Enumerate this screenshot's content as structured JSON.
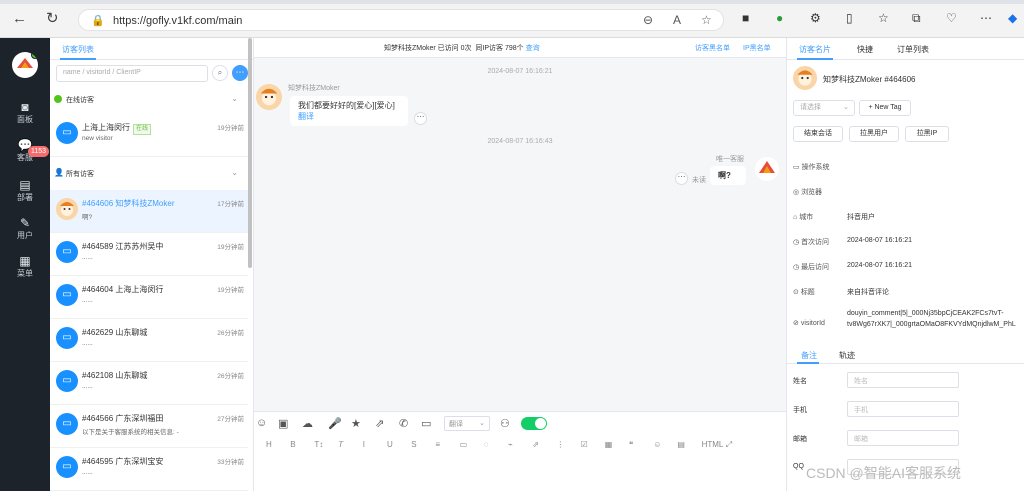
{
  "browser": {
    "url": "https://gofly.v1kf.com/main"
  },
  "sidebar": {
    "items": [
      "面板",
      "客服",
      "部署",
      "用户",
      "菜单"
    ],
    "badge": "1153"
  },
  "visitors": {
    "tab": "访客列表",
    "search_placeholder": "name / visitorId / ClientIP",
    "online_group": "在线访客",
    "all_group": "所有访客",
    "online": [
      {
        "name": "上海上海闵行",
        "tag": "在线",
        "time": "19分钟前",
        "msg": "new visitor"
      }
    ],
    "list": [
      {
        "name": "#464606 知梦科技ZMoker",
        "time": "17分钟前",
        "msg": "啊?"
      },
      {
        "name": "#464589 江苏苏州吴中",
        "time": "19分钟前",
        "msg": "......"
      },
      {
        "name": "#464604 上海上海闵行",
        "time": "19分钟前",
        "msg": "......"
      },
      {
        "name": "#462629 山东聊城",
        "time": "26分钟前",
        "msg": "......"
      },
      {
        "name": "#462108 山东聊城",
        "time": "26分钟前",
        "msg": "......"
      },
      {
        "name": "#464566 广东深圳福田",
        "time": "27分钟前",
        "msg": "以下是关于客服系统的相关信息: -"
      },
      {
        "name": "#464595 广东深圳宝安",
        "time": "33分钟前",
        "msg": "......"
      }
    ]
  },
  "chat": {
    "header": {
      "prefix": "知梦科技ZMoker 已访问 0次",
      "same_ip": "同IP访客",
      "count": "798个",
      "query": "查询",
      "blacklist": "访客黑名单",
      "ip_blacklist": "IP黑名单"
    },
    "messages": [
      {
        "time": "2024-08-07 16:16:21",
        "sender": "知梦科技ZMoker",
        "text": "我们都要好好的[爱心][爱心]",
        "translate": "翻译"
      },
      {
        "time": "2024-08-07 16:16:43",
        "sender": "唯一客服",
        "text": "啊?",
        "status": "未读"
      }
    ],
    "toolbar": {
      "translate": "翻译",
      "fmt": [
        "H",
        "B",
        "T↕",
        "𝑇",
        "I",
        "U",
        "S",
        "≡",
        "▭",
        "◌",
        "⌁",
        "⇗",
        "⋮",
        "☑",
        "▦",
        "❝",
        "☺",
        "▤",
        "HTML",
        "⤢"
      ]
    }
  },
  "info": {
    "tabs": [
      "访客名片",
      "快捷",
      "订单列表"
    ],
    "name": "知梦科技ZMoker #464606",
    "select_placeholder": "请选择",
    "new_tag": "+ New Tag",
    "buttons": [
      "结束会话",
      "拉黑用户",
      "拉黑IP"
    ],
    "rows": [
      {
        "k": "操作系统",
        "v": ""
      },
      {
        "k": "浏览器",
        "v": ""
      },
      {
        "k": "城市",
        "v": "抖音用户"
      },
      {
        "k": "首次访问",
        "v": "2024-08-07 16:16:21"
      },
      {
        "k": "最后访问",
        "v": "2024-08-07 16:16:21"
      },
      {
        "k": "标题",
        "v": "来自抖音评论"
      },
      {
        "k": "visitorId",
        "v": "douyin_comment|5|_000Nj35bpCjCEAK2FCs7tvT-",
        "v2": "tv8Wg67rXK7|_000grtaOMaO8FKVYdMQnjdlwM_PhL"
      }
    ],
    "note_tabs": [
      "备注",
      "轨迹"
    ],
    "fields": [
      {
        "label": "姓名",
        "placeholder": "姓名"
      },
      {
        "label": "手机",
        "placeholder": "手机"
      },
      {
        "label": "邮箱",
        "placeholder": "邮箱"
      },
      {
        "label": "QQ",
        "placeholder": ""
      }
    ]
  },
  "watermark": "CSDN @智能AI客服系统"
}
